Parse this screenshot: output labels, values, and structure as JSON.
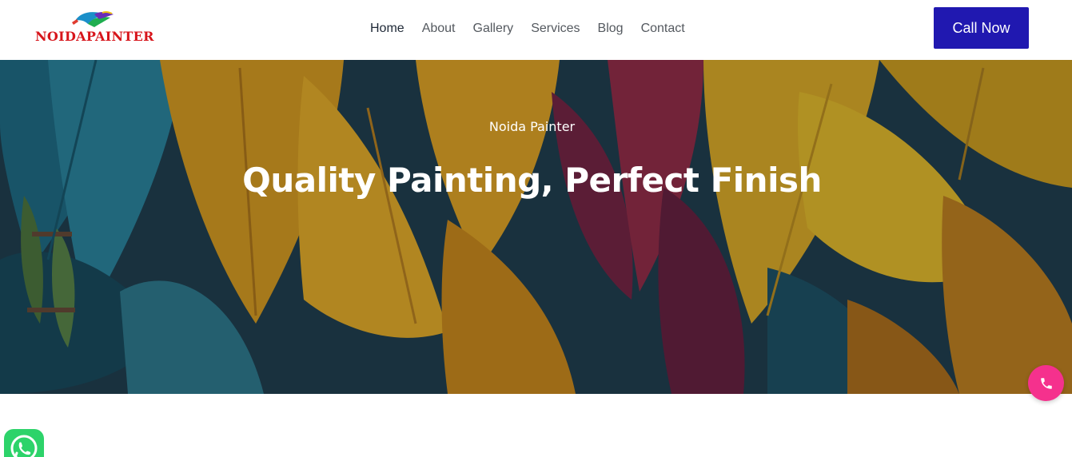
{
  "brand": {
    "logo_text": "NOIDAPAINTER"
  },
  "nav": {
    "items": [
      {
        "label": "Home",
        "active": true
      },
      {
        "label": "About",
        "active": false
      },
      {
        "label": "Gallery",
        "active": false
      },
      {
        "label": "Services",
        "active": false
      },
      {
        "label": "Blog",
        "active": false
      },
      {
        "label": "Contact",
        "active": false
      }
    ]
  },
  "header": {
    "cta_label": "Call Now"
  },
  "hero": {
    "kicker": "Noida Painter",
    "title": "Quality Painting, Perfect Finish",
    "background_image": "tropical-leaf-mural"
  },
  "floating": {
    "phone_icon": "phone-icon",
    "whatsapp_icon": "whatsapp-icon"
  },
  "colors": {
    "brand_red": "#d7151b",
    "cta_blue": "#2018b0",
    "fab_pink": "#f5318d",
    "whatsapp_green": "#2dd36a"
  }
}
